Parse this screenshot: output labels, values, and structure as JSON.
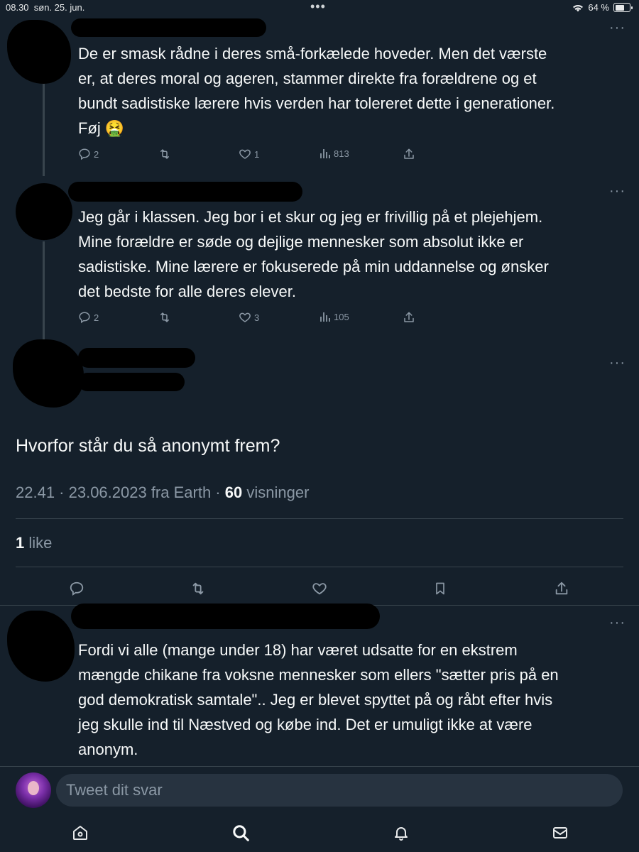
{
  "status_bar": {
    "time": "08.30",
    "date": "søn. 25. jun.",
    "battery": "64 %"
  },
  "tweets": [
    {
      "text": "De er smask rådne i deres små-forkælede hoveder. Men det værste\ner, at deres moral og ageren, stammer direkte fra forældrene og et\nbundt sadistiske lærere hvis verden har tolereret dette i generationer.\nFøj 🤮",
      "replies": "2",
      "retweets": "",
      "likes": "1",
      "views": "813"
    },
    {
      "text": "Jeg går i klassen. Jeg bor i et skur og jeg er frivillig på et plejehjem.\nMine forældre er søde og dejlige mennesker som absolut ikke er\nsadistiske. Mine lærere er fokuserede på min uddannelse og ønsker\ndet bedste for alle deres elever.",
      "replies": "2",
      "retweets": "",
      "likes": "3",
      "views": "105"
    }
  ],
  "main_tweet": {
    "text": "Hvorfor står du så anonymt frem?",
    "meta_prefix": "22.41 · 23.06.2023 fra Earth · ",
    "views_count": "60",
    "views_label": " visninger",
    "likes_count": "1",
    "likes_label": " like"
  },
  "reply_tweet": {
    "text": "Fordi vi alle (mange under 18) har været udsatte for en ekstrem\nmængde chikane fra voksne mennesker som ellers \"sætter pris på en\ngod demokratisk samtale\".. Jeg er blevet spyttet på og råbt efter hvis\njeg skulle ind til Næstved og købe ind. Det er umuligt ikke at være\nanonym."
  },
  "reply_box": {
    "placeholder": "Tweet dit svar"
  },
  "icons": {
    "reply": "reply-icon",
    "retweet": "retweet-icon",
    "like": "like-icon",
    "views": "views-icon",
    "share": "share-icon",
    "bookmark": "bookmark-icon",
    "home": "home-icon",
    "search": "search-icon",
    "notifications": "bell-icon",
    "messages": "mail-icon"
  },
  "colors": {
    "background": "#15202b",
    "secondary_text": "#8b98a5",
    "divider": "#38444d"
  }
}
